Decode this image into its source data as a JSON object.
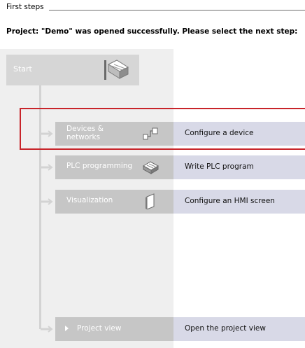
{
  "header": {
    "title": "First steps"
  },
  "subtitle": "Project: \"Demo\" was opened successfully. Please select the next step:",
  "start": {
    "label": "Start",
    "icon": "start-portal-icon"
  },
  "rows": [
    {
      "label": "Devices &\nnetworks",
      "icon": "devices-networks-icon",
      "action": "Configure a device",
      "highlighted": true
    },
    {
      "label": "PLC programming",
      "icon": "plc-programming-icon",
      "action": "Write PLC program"
    },
    {
      "label": "Visualization",
      "icon": "visualization-icon",
      "action": "Configure an HMI screen"
    }
  ],
  "project_view": {
    "label": "Project view",
    "icon": "play-icon",
    "action": "Open the project view"
  },
  "colors": {
    "left_panel": "#efefef",
    "row_left": "#c6c6c6",
    "row_right": "#d8d9e7",
    "highlight": "#c8242a",
    "tree_line": "#d3d3d3"
  }
}
